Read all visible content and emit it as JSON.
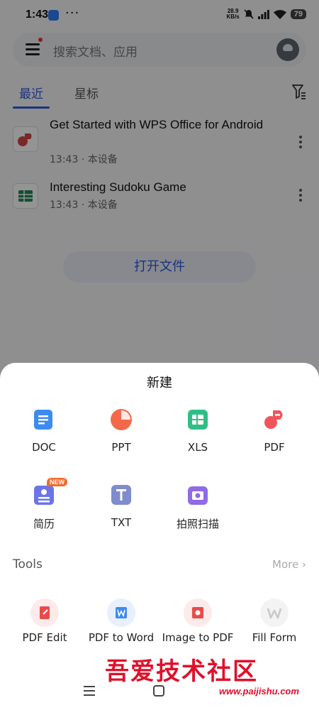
{
  "status_bar": {
    "time": "1:43",
    "more": "···",
    "net_speed_value": "28.9",
    "net_speed_unit": "KB/s",
    "battery": "79"
  },
  "search": {
    "placeholder": "搜索文档、应用"
  },
  "tabs": [
    {
      "label": "最近"
    },
    {
      "label": "星标"
    }
  ],
  "files": [
    {
      "title": "Get Started with WPS Office for Android",
      "meta": "13:43 · 本设备",
      "icon": "pdf-icon"
    },
    {
      "title": "Interesting Sudoku Game",
      "meta": "13:43 · 本设备",
      "icon": "xls-icon"
    }
  ],
  "open_button": "打开文件",
  "sheet": {
    "title": "新建",
    "create": [
      {
        "label": "DOC",
        "icon": "doc-icon",
        "color": "#3d8bf2"
      },
      {
        "label": "PPT",
        "icon": "ppt-icon",
        "color": "#f2694a"
      },
      {
        "label": "XLS",
        "icon": "xls-icon",
        "color": "#2fbf85"
      },
      {
        "label": "PDF",
        "icon": "pdf-icon",
        "color": "#f2545b"
      },
      {
        "label": "简历",
        "icon": "resume-icon",
        "color": "#6b74e8",
        "badge": "NEW"
      },
      {
        "label": "TXT",
        "icon": "txt-icon",
        "color": "#7f8ccd"
      },
      {
        "label": "拍照扫描",
        "icon": "camera-scan-icon",
        "color": "#8f6be6"
      }
    ],
    "tools_title": "Tools",
    "more_label": "More",
    "tools": [
      {
        "label": "PDF Edit",
        "icon": "pdf-edit-icon",
        "color": "#fdeaea"
      },
      {
        "label": "PDF to Word",
        "icon": "pdf-to-word-icon",
        "color": "#e7f0fc"
      },
      {
        "label": "Image to PDF",
        "icon": "image-to-pdf-icon",
        "color": "#fdeaea"
      },
      {
        "label": "Fill Form",
        "icon": "fill-form-icon",
        "color": "#f3f3f3"
      }
    ]
  },
  "watermark": {
    "text": "吾爱技术社区",
    "url": "www.paijishu.com"
  }
}
